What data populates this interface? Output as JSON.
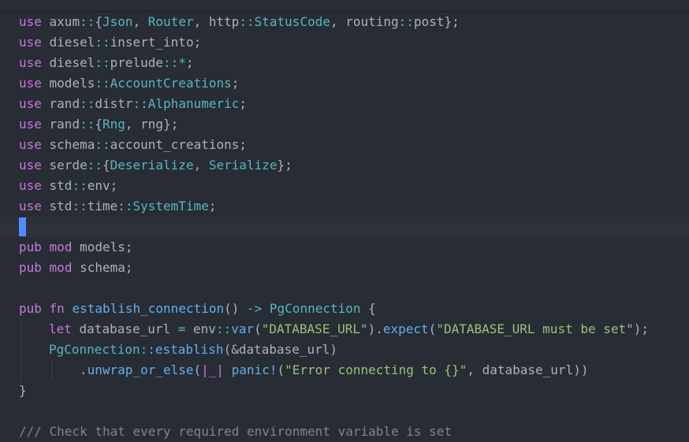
{
  "lines": {
    "l1": [
      "use",
      " axum",
      "::",
      "{",
      "Json",
      ", ",
      "Router",
      ", http",
      "::",
      "StatusCode",
      ", routing",
      "::",
      "post",
      "};"
    ],
    "l2": [
      "use",
      " diesel",
      "::",
      "insert_into;"
    ],
    "l3": [
      "use",
      " diesel",
      "::",
      "prelude",
      "::",
      "*",
      ";"
    ],
    "l4": [
      "use",
      " models",
      "::",
      "AccountCreations",
      ";"
    ],
    "l5": [
      "use",
      " rand",
      "::",
      "distr",
      "::",
      "Alphanumeric",
      ";"
    ],
    "l6": [
      "use",
      " rand",
      "::",
      "{",
      "Rng",
      ", rng};"
    ],
    "l7": [
      "use",
      " schema",
      "::",
      "account_creations;"
    ],
    "l8": [
      "use",
      " serde",
      "::",
      "{",
      "Deserialize",
      ", ",
      "Serialize",
      "};"
    ],
    "l9": [
      "use",
      " std",
      "::",
      "env;"
    ],
    "l10": [
      "use",
      " std",
      "::",
      "time",
      "::",
      "SystemTime",
      ";"
    ],
    "l12": [
      "pub",
      " ",
      "mod",
      " models;"
    ],
    "l13": [
      "pub",
      " ",
      "mod",
      " schema;"
    ],
    "l15": [
      "pub",
      " ",
      "fn",
      " ",
      "establish_connection",
      "() ",
      "->",
      " ",
      "PgConnection",
      " {"
    ],
    "l16": [
      "let",
      " database_url ",
      "=",
      " env",
      "::",
      "var",
      "(",
      "\"DATABASE_URL\"",
      ").",
      "expect",
      "(",
      "\"DATABASE_URL must be set\"",
      ");"
    ],
    "l17": [
      "PgConnection",
      "::",
      "establish",
      "(&database_url)"
    ],
    "l18": [
      ".",
      "unwrap_or_else",
      "(",
      "|_|",
      " ",
      "panic",
      "!",
      "(",
      "\"Error connecting to {}\"",
      ", database_url))"
    ],
    "l19": [
      "}"
    ],
    "l21": [
      "/// Check that every required environment variable is set"
    ]
  }
}
